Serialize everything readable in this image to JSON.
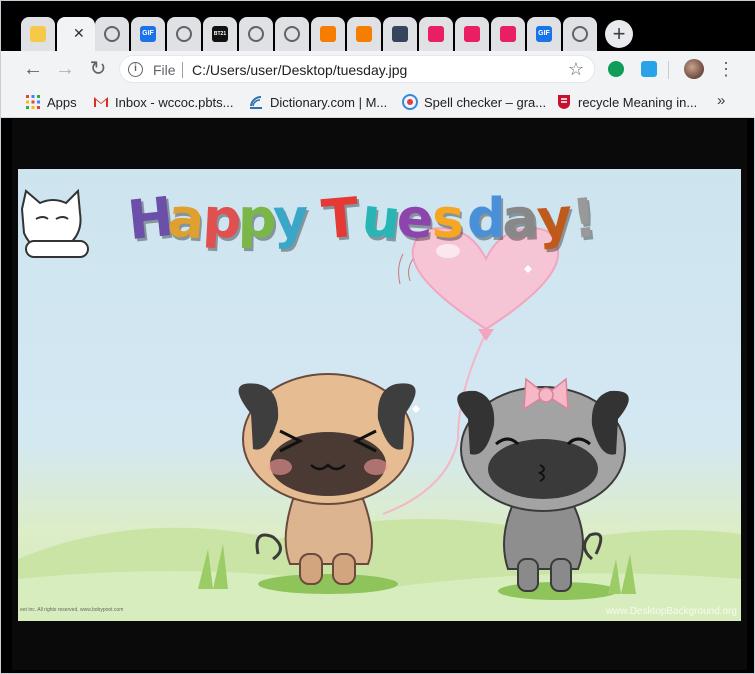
{
  "tabs": [
    {
      "icon": "lock-folder-icon",
      "color": "#f7c948"
    },
    {
      "icon": "active-tab",
      "color": "#f2f3f5"
    },
    {
      "icon": "globe-icon",
      "color": "#5f6368"
    },
    {
      "icon": "gif-icon",
      "color": "#1a73e8",
      "label": "GIF"
    },
    {
      "icon": "globe-icon",
      "color": "#5f6368"
    },
    {
      "icon": "bt21-icon",
      "color": "#111111",
      "label": "BT21"
    },
    {
      "icon": "globe-icon",
      "color": "#5f6368"
    },
    {
      "icon": "globe-icon",
      "color": "#5f6368"
    },
    {
      "icon": "blogger-icon",
      "color": "#f57d00"
    },
    {
      "icon": "blogger-icon",
      "color": "#f57d00"
    },
    {
      "icon": "tumblr-icon",
      "color": "#35465c"
    },
    {
      "icon": "multicolor-icon",
      "color": "#e91e63"
    },
    {
      "icon": "multicolor-icon",
      "color": "#e91e63"
    },
    {
      "icon": "multicolor-icon",
      "color": "#e91e63"
    },
    {
      "icon": "gif-icon",
      "color": "#1a73e8",
      "label": "GIF"
    },
    {
      "icon": "globe-icon",
      "color": "#5f6368"
    }
  ],
  "toolbar": {
    "scheme": "File",
    "url": "C:/Users/user/Desktop/tuesday.jpg"
  },
  "bookmarks": [
    {
      "icon": "apps-grid-icon",
      "label": "Apps"
    },
    {
      "icon": "gmail-icon",
      "label": "Inbox - wccoc.pbts..."
    },
    {
      "icon": "dictionary-icon",
      "label": "Dictionary.com | M..."
    },
    {
      "icon": "grammarly-icon",
      "label": "Spell checker – gra..."
    },
    {
      "icon": "cambridge-icon",
      "label": "recycle Meaning in..."
    }
  ],
  "image": {
    "title": "Happy Tuesday!",
    "title_colors": [
      "#6b4fa8",
      "#e0a030",
      "#e05050",
      "#7ab648",
      "#3aa7c8",
      "#3b6fc9",
      "#e53935",
      "#28b5b5",
      "#8e44ad",
      "#f5a623",
      "#4a90d9",
      "#888888",
      "#c05a1a",
      "#999999"
    ],
    "logo_text": "bobypoot",
    "credit": "eet inc. All rights reserved. www.bobypoot.com",
    "watermark": "www.DesktopBackground.org"
  }
}
